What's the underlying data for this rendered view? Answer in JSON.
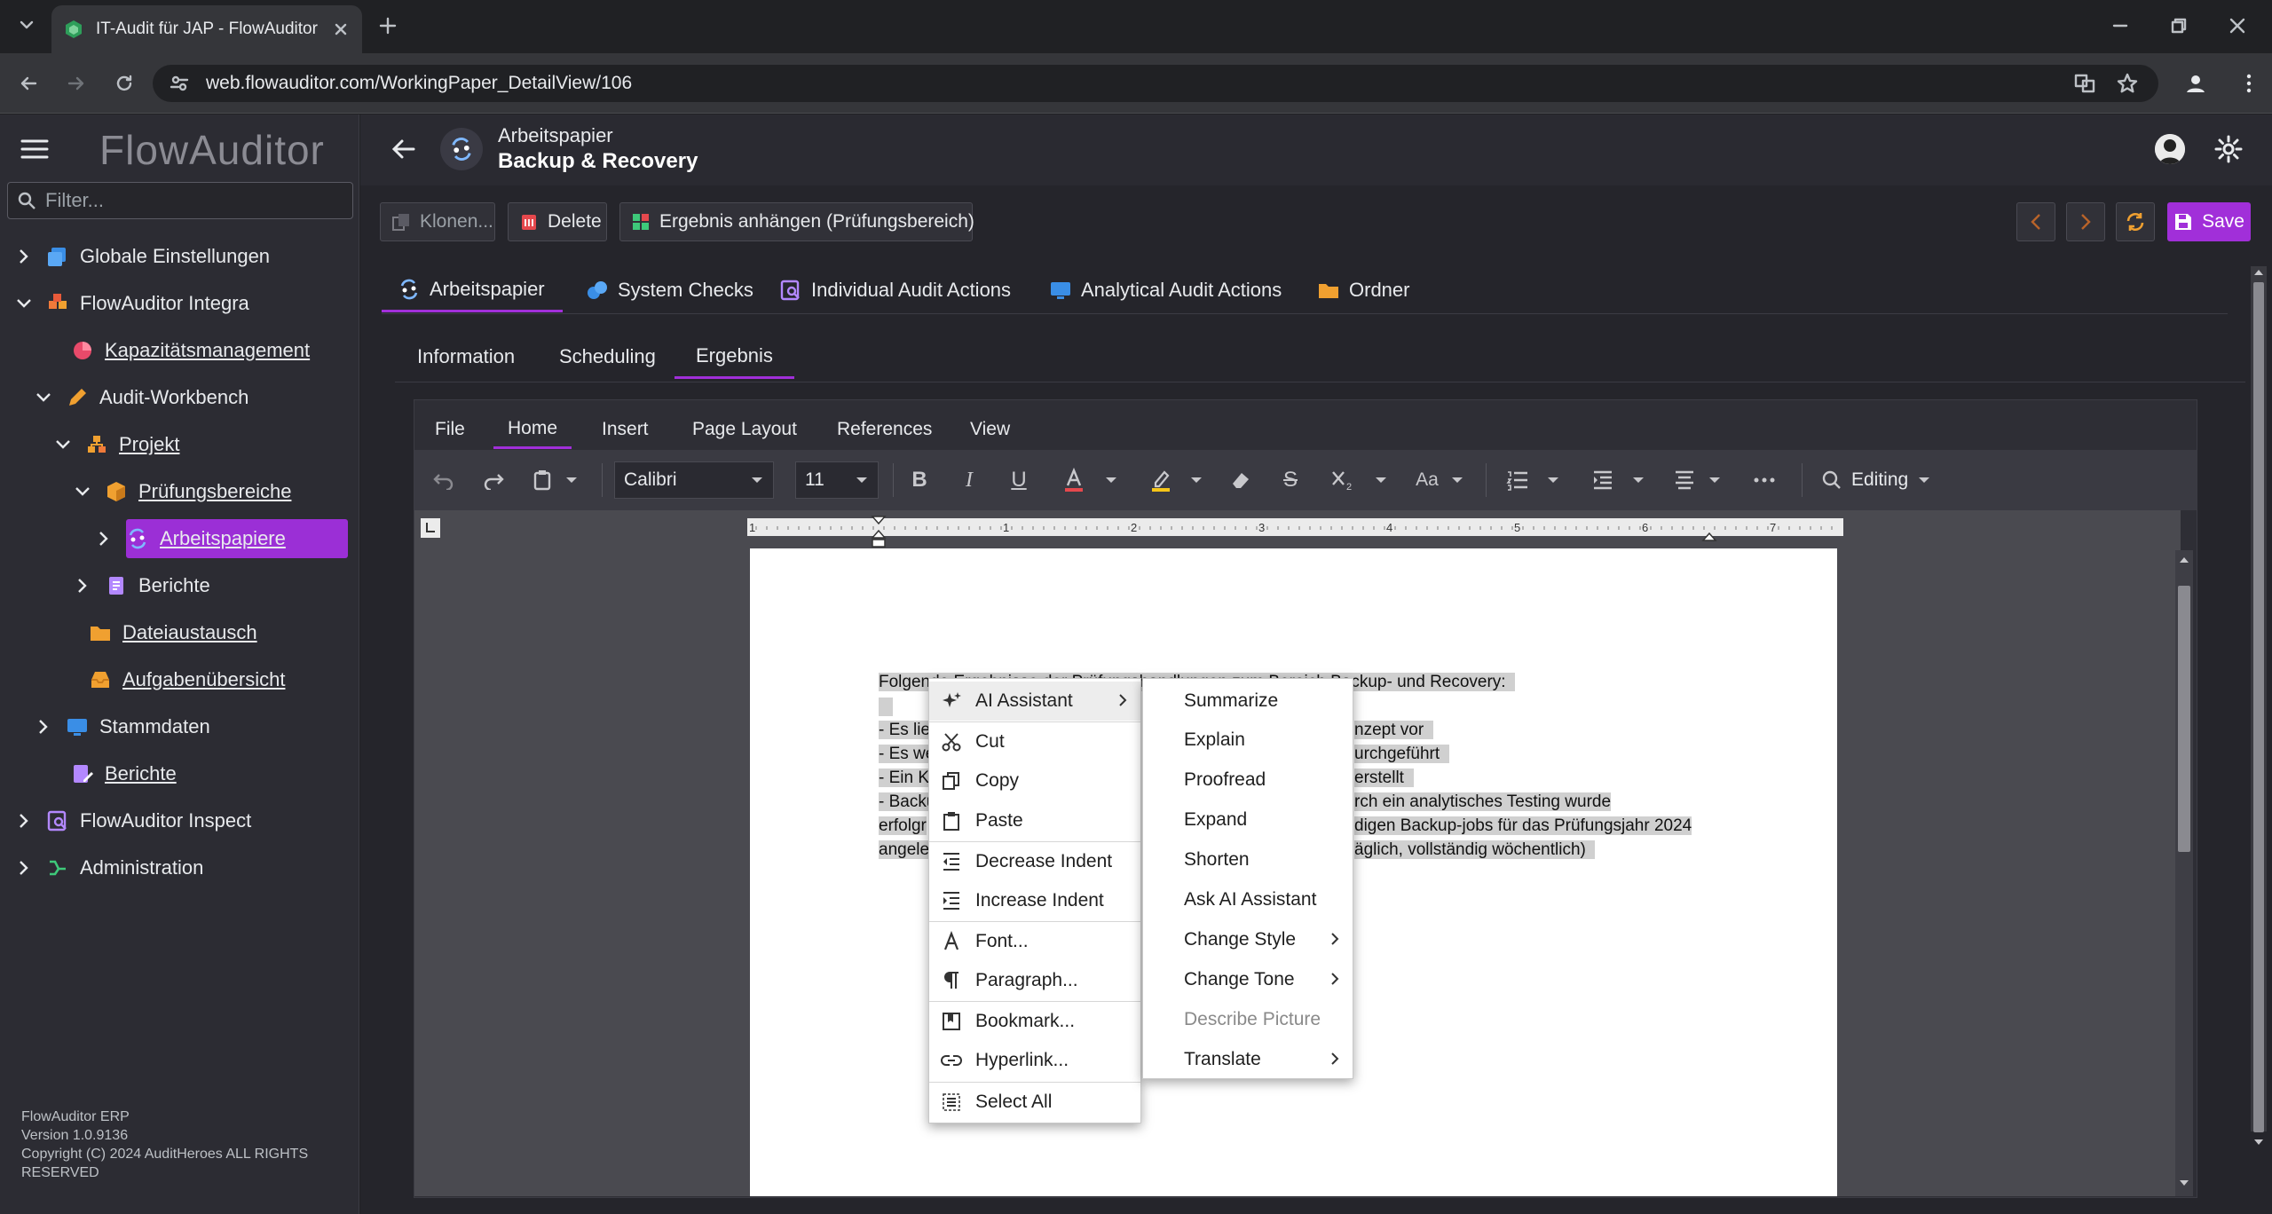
{
  "browser": {
    "tab_title": "IT-Audit für JAP - FlowAuditor E",
    "url": "web.flowauditor.com/WorkingPaper_DetailView/106"
  },
  "app": {
    "logo": "FlowAuditor",
    "filter_placeholder": "Filter...",
    "header_subtitle": "Arbeitspapier",
    "header_title": "Backup & Recovery",
    "footer": [
      "FlowAuditor ERP",
      "Version 1.0.9136",
      "Copyright (C) 2024 AuditHeroes ALL RIGHTS",
      "RESERVED"
    ]
  },
  "sidebar": {
    "items": [
      {
        "label": "Globale Einstellungen"
      },
      {
        "label": "FlowAuditor Integra"
      },
      {
        "label": "Kapazitätsmanagement"
      },
      {
        "label": "Audit-Workbench"
      },
      {
        "label": "Projekt"
      },
      {
        "label": "Prüfungsbereiche"
      },
      {
        "label": "Arbeitspapiere"
      },
      {
        "label": "Berichte"
      },
      {
        "label": "Dateiaustausch"
      },
      {
        "label": "Aufgabenübersicht"
      },
      {
        "label": "Stammdaten"
      },
      {
        "label": "Berichte"
      },
      {
        "label": "FlowAuditor Inspect"
      },
      {
        "label": "Administration"
      }
    ]
  },
  "actions": {
    "clone": "Klonen...",
    "delete": "Delete",
    "attach": "Ergebnis anhängen (Prüfungsbereich)",
    "save": "Save"
  },
  "tabs": [
    "Arbeitspapier",
    "System Checks",
    "Individual Audit Actions",
    "Analytical Audit Actions",
    "Ordner"
  ],
  "subtabs": [
    "Information",
    "Scheduling",
    "Ergebnis"
  ],
  "editor": {
    "ribbon_tabs": [
      "File",
      "Home",
      "Insert",
      "Page Layout",
      "References",
      "View"
    ],
    "font": "Calibri",
    "size": "11",
    "mode": "Editing",
    "ruler_numbers": [
      "1",
      "1",
      "2",
      "3",
      "4",
      "5",
      "6",
      "7"
    ],
    "doc_lines": [
      "Folgende Ergebnisse der Prüfungshandlungen zum Bereich Backup- und Recovery:",
      "",
      "- Es liegt ein dokumentiertes Backup-Konzept vor",
      "- Es werden regelmäßig Backups durchgeführt",
      "- Ein Konzept ist erstellt",
      "- Backups werden überwacht, durch ein analytisches Testing wurde",
      "erfolgreich die Durchführung der notwendigen Backup-jobs für das Prüfungsjahr 2024",
      "angelegt (täglich, vollständig wöchentlich)"
    ],
    "visible_fragments": {
      "l1a": "Folgende Ergebnisse der Prüfungshandlungen zum Bereich Backup- und Recovery:",
      "l3a": "- Es lie",
      "l3b": "nzept vor",
      "l4a": "- Es we",
      "l4b": "urchgeführt",
      "l5a": "- Ein K",
      "l5b": "erstellt",
      "l6a": "- Backu",
      "l6b": "rch ein analytisches Testing wurde",
      "l7a": "erfolgr",
      "l7b": "digen Backup-jobs für das Prüfungsjahr 2024",
      "l8a": "angele",
      "l8b": "äglich, vollständig wöchentlich)"
    }
  },
  "context_menu": [
    {
      "label": "AI Assistant",
      "icon": "sparkle-icon"
    },
    {
      "label": "Cut",
      "icon": "scissors-icon"
    },
    {
      "label": "Copy",
      "icon": "copy-icon"
    },
    {
      "label": "Paste",
      "icon": "paste-icon"
    },
    {
      "label": "Decrease Indent",
      "icon": "decrease-indent-icon"
    },
    {
      "label": "Increase Indent",
      "icon": "increase-indent-icon"
    },
    {
      "label": "Font...",
      "icon": "font-icon"
    },
    {
      "label": "Paragraph...",
      "icon": "paragraph-icon"
    },
    {
      "label": "Bookmark...",
      "icon": "bookmark-icon"
    },
    {
      "label": "Hyperlink...",
      "icon": "hyperlink-icon"
    },
    {
      "label": "Select All",
      "icon": "select-all-icon"
    }
  ],
  "ai_submenu": [
    "Summarize",
    "Explain",
    "Proofread",
    "Expand",
    "Shorten",
    "Ask AI Assistant",
    "Change Style",
    "Change Tone",
    "Describe Picture",
    "Translate"
  ],
  "colors": {
    "accent": "#a12fd9",
    "selected_nav": "#9b2fd6",
    "delete": "#e5484d",
    "orange": "#f0a030"
  }
}
